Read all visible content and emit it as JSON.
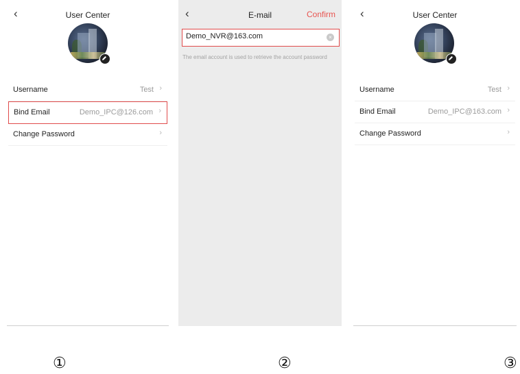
{
  "screen1": {
    "back_icon": "‹",
    "title": "User Center",
    "rows": [
      {
        "label": "Username",
        "value": "Test",
        "chevron": "›"
      },
      {
        "label": "Bind Email",
        "value": "Demo_IPC@126.com",
        "chevron": "›"
      },
      {
        "label": "Change Password",
        "value": "",
        "chevron": "›"
      }
    ],
    "highlight_color": "#e04a4a"
  },
  "screen2": {
    "back_icon": "‹",
    "title": "E-mail",
    "confirm_label": "Confirm",
    "confirm_color": "#e8534f",
    "email_value": "Demo_NVR@163.com",
    "clear_icon": "×",
    "hint": "The email account is used to retrieve the account password"
  },
  "screen3": {
    "back_icon": "‹",
    "title": "User Center",
    "rows": [
      {
        "label": "Username",
        "value": "Test",
        "chevron": "›"
      },
      {
        "label": "Bind Email",
        "value": "Demo_IPC@163.com",
        "chevron": "›"
      },
      {
        "label": "Change Password",
        "value": "",
        "chevron": "›"
      }
    ]
  },
  "steps": [
    "①",
    "②",
    "③"
  ]
}
